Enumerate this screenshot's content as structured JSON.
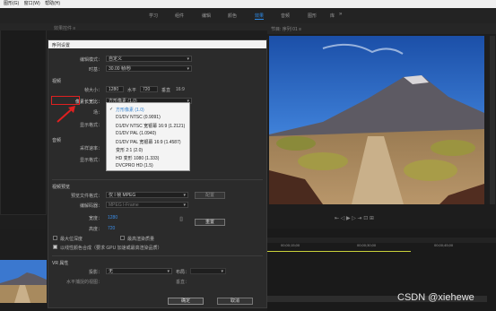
{
  "menubar": {
    "items": [
      "图形(G)",
      "窗口(W)",
      "帮助(H)"
    ]
  },
  "workspaces": {
    "tabs": [
      "学习",
      "组件",
      "编辑",
      "颜色",
      "效果",
      "音频",
      "图形",
      "库"
    ],
    "active": "效果",
    "overflow": "»"
  },
  "source_panel": {
    "header": "效果控件 ≡"
  },
  "program_panel": {
    "header": "节目: 序列 01 ≡"
  },
  "dialog": {
    "title": "序列设置",
    "close": "×",
    "editing_mode_label": "编辑模式：",
    "editing_mode_value": "自定义",
    "timebase_label": "时基：",
    "timebase_value": "30.00 帧/秒",
    "video_section": "视频",
    "frame_size_label": "帧大小：",
    "frame_width": "1280",
    "horizontal_label": "水平",
    "frame_height": "720",
    "vertical_label": "垂直",
    "aspect_ratio": "16:9",
    "pixel_aspect_label": "像素长宽比：",
    "pixel_aspect_value": "方形像素 (1.0)",
    "field_label": "场：",
    "display_format_label": "显示格式：",
    "audio_section": "音频",
    "sample_rate_label": "采样速率：",
    "audio_display_label": "显示格式：",
    "preview_section": "视频预览",
    "preview_format_label": "预览文件格式：",
    "preview_format_value": "仅 I 帧 MPEG",
    "preview_configure": "配置",
    "codec_label": "编解码器：",
    "codec_value": "MPEG I-Frame",
    "width_label": "宽度：",
    "width_value": "1280",
    "height_label": "高度：",
    "height_value": "720",
    "reset_button": "重置",
    "max_bit_depth": "最大位深度",
    "max_render_quality": "最高渲染质量",
    "linear_composite": "以线性颜色合成（要求 GPU 加速或最高渲染品质）",
    "vr_section": "VR 属性",
    "projection_label": "投影：",
    "projection_value": "无",
    "layout_label": "布局：",
    "horizontal_view_label": "水平捕捉的视图：",
    "vertical_label2": "垂直：",
    "ok_button": "确定",
    "cancel_button": "取消"
  },
  "pixel_aspect_options": [
    "方形像素 (1.0)",
    "D1/DV NTSC (0.9091)",
    "D1/DV NTSC 宽银幕 16:9 (1.2121)",
    "D1/DV PAL (1.0940)",
    "D1/DV PAL 宽银幕 16:9 (1.4587)",
    "变形 2:1 (2.0)",
    "HD 变形 1080 (1.333)",
    "DVCPRO HD (1.5)"
  ],
  "timeline": {
    "times": [
      "00;00;15;00",
      "00;00;30;00",
      "00;00;45;00"
    ]
  },
  "watermark": "CSDN @xiehewe",
  "colors": {
    "accent": "#2d8ceb",
    "highlight_box": "#e02020"
  }
}
